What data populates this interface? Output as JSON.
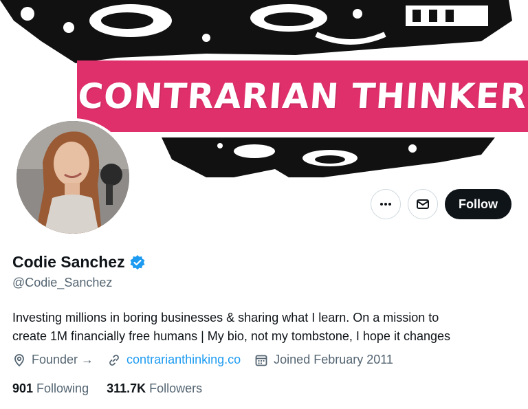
{
  "banner": {
    "title": "CONTRARIAN THINKER",
    "accent_color": "#e0306b"
  },
  "profile": {
    "display_name": "Codie Sanchez",
    "verified_icon": "verified-badge-icon",
    "handle": "@Codie_Sanchez",
    "bio_line1": "Investing millions in boring businesses & sharing what I learn. On a mission to",
    "bio_line2": "create 1M financially free humans | My bio, not my tombstone, I hope it changes"
  },
  "actions": {
    "more_icon": "more-icon",
    "message_icon": "envelope-icon",
    "follow_label": "Follow"
  },
  "meta": {
    "category": "Founder →",
    "category_icon": "location-pin-icon",
    "website": "contrarianthinking.co",
    "website_icon": "link-icon",
    "joined": "Joined February 2011",
    "joined_icon": "calendar-icon"
  },
  "stats": {
    "following_count": "901",
    "following_label": "Following",
    "followers_count": "311.7K",
    "followers_label": "Followers"
  },
  "colors": {
    "text": "#0f1419",
    "muted": "#536471",
    "link": "#1d9bf0",
    "border": "#cfd9de"
  }
}
